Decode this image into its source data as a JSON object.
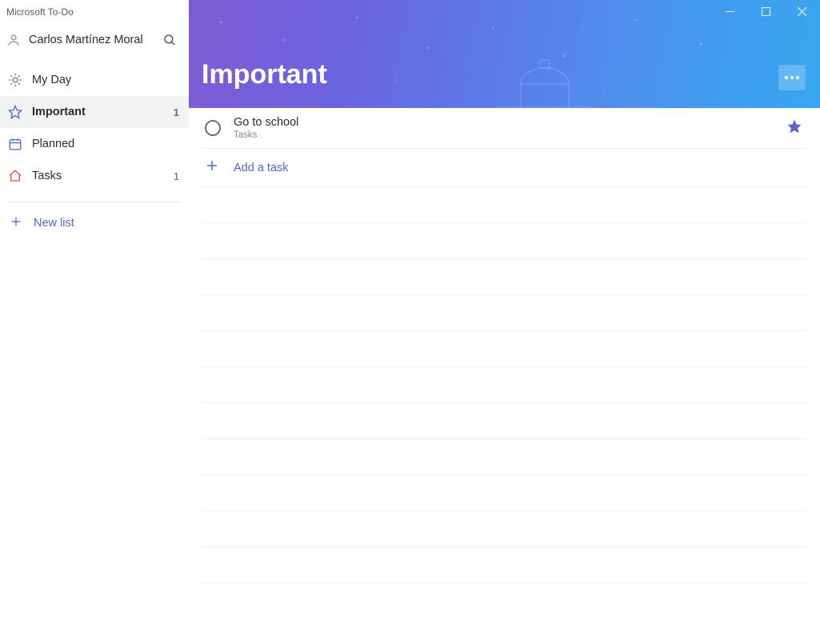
{
  "app": {
    "title": "Microsoft To-Do"
  },
  "user": {
    "name": "Carlos Martínez Moral"
  },
  "sidebar": {
    "items": [
      {
        "label": "My Day",
        "count": ""
      },
      {
        "label": "Important",
        "count": "1"
      },
      {
        "label": "Planned",
        "count": ""
      },
      {
        "label": "Tasks",
        "count": "1"
      }
    ],
    "new_list_label": "New list"
  },
  "header": {
    "title": "Important"
  },
  "tasks": [
    {
      "title": "Go to school",
      "list": "Tasks",
      "starred": true
    }
  ],
  "add_task": {
    "label": "Add a task"
  },
  "colors": {
    "accent": "#4b68d6",
    "star_fill": "#5b62d8",
    "myday": "#7a7a7a",
    "important": "#4b68d6",
    "planned": "#4b68d6",
    "tasks": "#d15b3a"
  }
}
